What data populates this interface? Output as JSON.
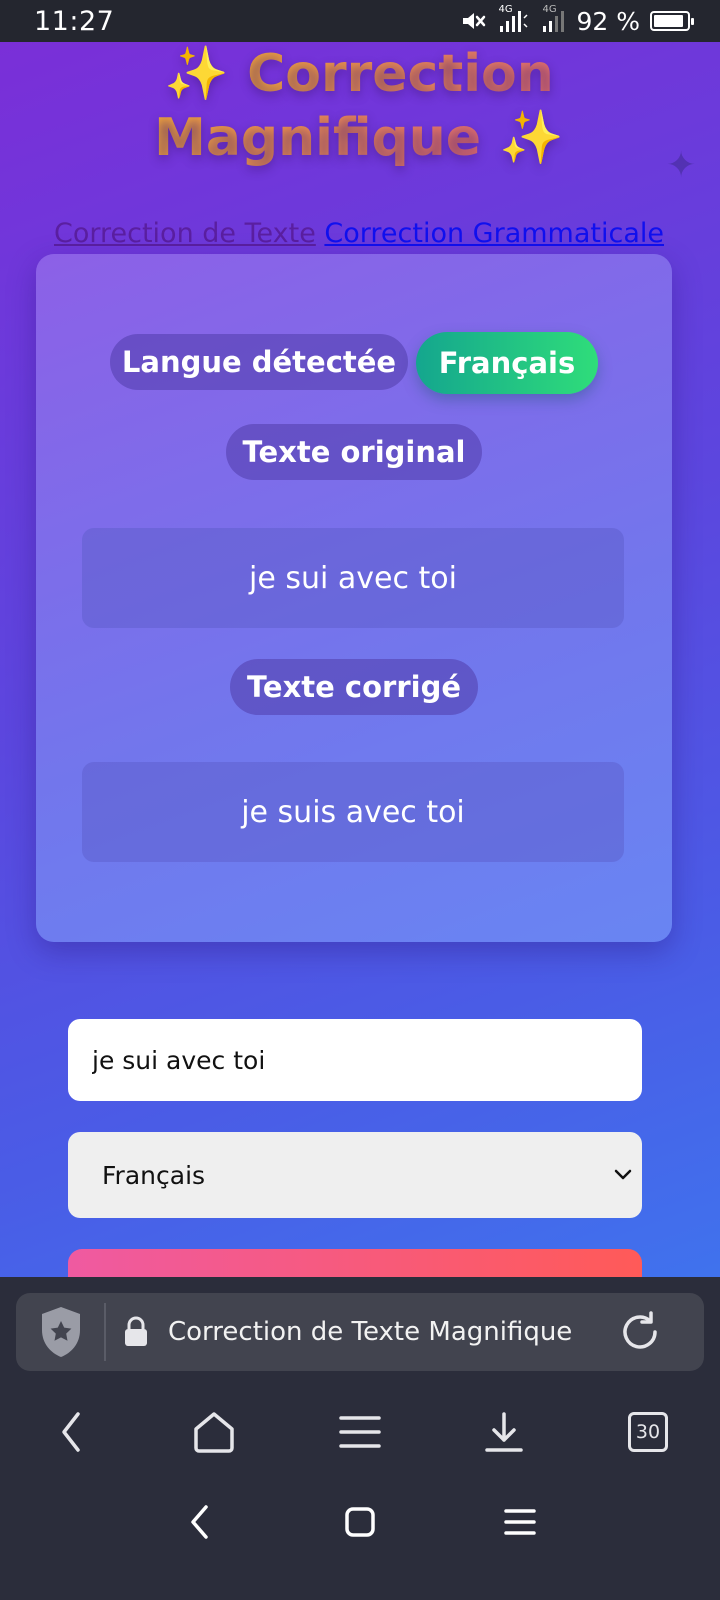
{
  "status_bar": {
    "time": "11:27",
    "network_1": "4G",
    "network_2": "4G",
    "battery_percent_text": "92 %",
    "battery_level": 0.92,
    "icons": [
      "mute-icon",
      "signal-icon",
      "battery-icon"
    ]
  },
  "page": {
    "title_line1": "Correction",
    "title_line2": "Magnifique",
    "sparkle": "✨",
    "nav_links": [
      {
        "label": "Correction de Texte",
        "state": "visited"
      },
      {
        "label": "Correction Grammaticale",
        "state": "unvisited"
      }
    ],
    "result": {
      "detected_language_label": "Langue détectée",
      "detected_language_value": "Français",
      "original_label": "Texte original",
      "original_text": "je sui avec toi",
      "corrected_label": "Texte corrigé",
      "corrected_text": "je suis avec toi"
    },
    "form": {
      "input_value": "je sui avec toi",
      "language_select_value": "Français"
    }
  },
  "browser": {
    "page_title": "Correction de Texte Magnifique",
    "tab_count": "30",
    "toolbar_icons": [
      "back-icon",
      "home-icon",
      "menu-icon",
      "download-icon",
      "tabs-icon"
    ]
  },
  "colors": {
    "background_gradient": [
      "#7a2fd8",
      "#3f74ee"
    ],
    "title_gradient": [
      "#f0a43d",
      "#e3706f"
    ],
    "language_pill": [
      "#14a68e",
      "#2fdd7a"
    ],
    "submit_button": [
      "#ef5aa1",
      "#ff5a58"
    ],
    "chrome": "#2b2d3b"
  }
}
